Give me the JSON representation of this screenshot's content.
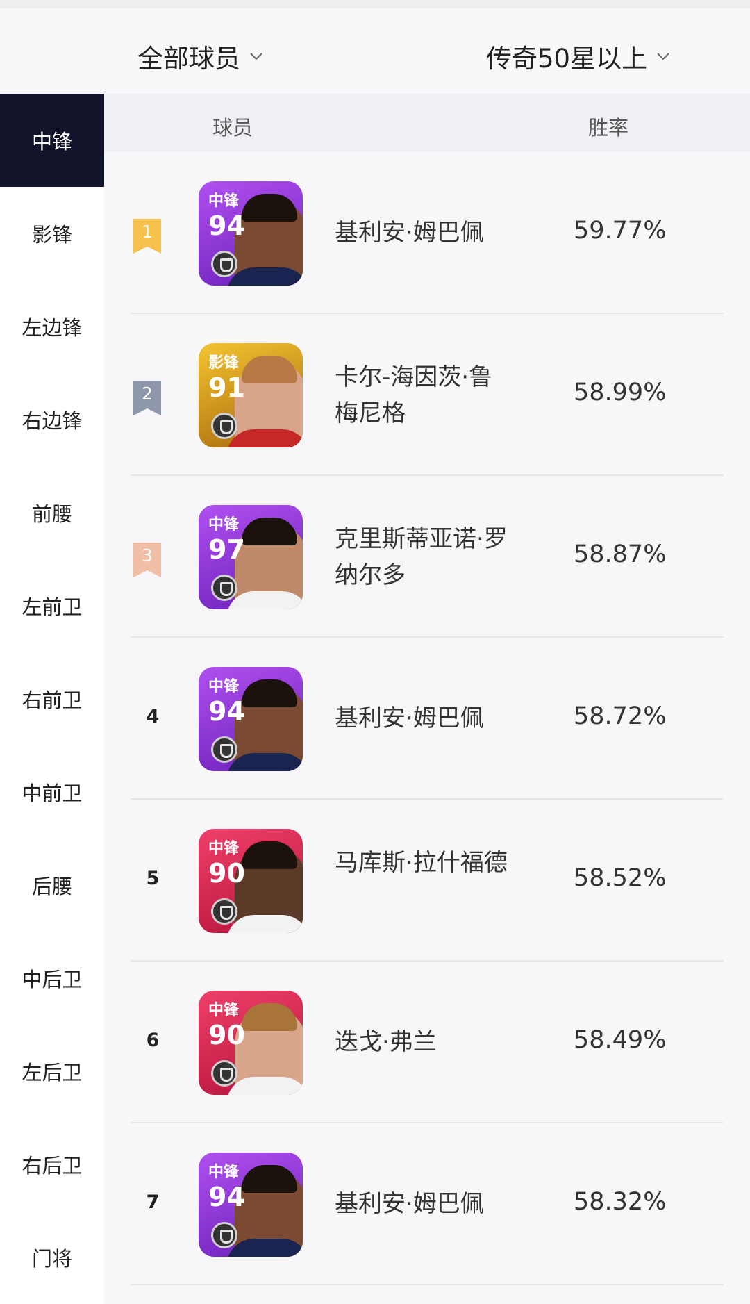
{
  "filters": {
    "player_filter": "全部球员",
    "tier_filter": "传奇50星以上"
  },
  "sidebar": {
    "items": [
      "中锋",
      "影锋",
      "左边锋",
      "右边锋",
      "前腰",
      "左前卫",
      "右前卫",
      "中前卫",
      "后腰",
      "中后卫",
      "左后卫",
      "右后卫",
      "门将"
    ],
    "active": "中锋"
  },
  "table": {
    "col_player": "球员",
    "col_winrate": "胜率",
    "rows": [
      {
        "rank": "1",
        "position": "中锋",
        "rating": "94",
        "name": "基利安·姆巴佩",
        "winrate": "59.77%"
      },
      {
        "rank": "2",
        "position": "影锋",
        "rating": "91",
        "name": "卡尔-海因茨·鲁梅尼格",
        "winrate": "58.99%"
      },
      {
        "rank": "3",
        "position": "中锋",
        "rating": "97",
        "name": "克里斯蒂亚诺·罗纳尔多",
        "winrate": "58.87%"
      },
      {
        "rank": "4",
        "position": "中锋",
        "rating": "94",
        "name": "基利安·姆巴佩",
        "winrate": "58.72%"
      },
      {
        "rank": "5",
        "position": "中锋",
        "rating": "90",
        "name": "马库斯·拉什福德",
        "winrate": "58.52%"
      },
      {
        "rank": "6",
        "position": "中锋",
        "rating": "90",
        "name": "迭戈·弗兰",
        "winrate": "58.49%"
      },
      {
        "rank": "7",
        "position": "中锋",
        "rating": "94",
        "name": "基利安·姆巴佩",
        "winrate": "58.32%"
      }
    ]
  },
  "colors": {
    "rank_1": "#f7c14e",
    "rank_2": "#8e97ab",
    "rank_3": "#f0bfa6",
    "card_purple": "#8a2fd8",
    "card_gold": "#c88a14",
    "card_red": "#d8244d",
    "sidebar_active": "#11142a"
  }
}
